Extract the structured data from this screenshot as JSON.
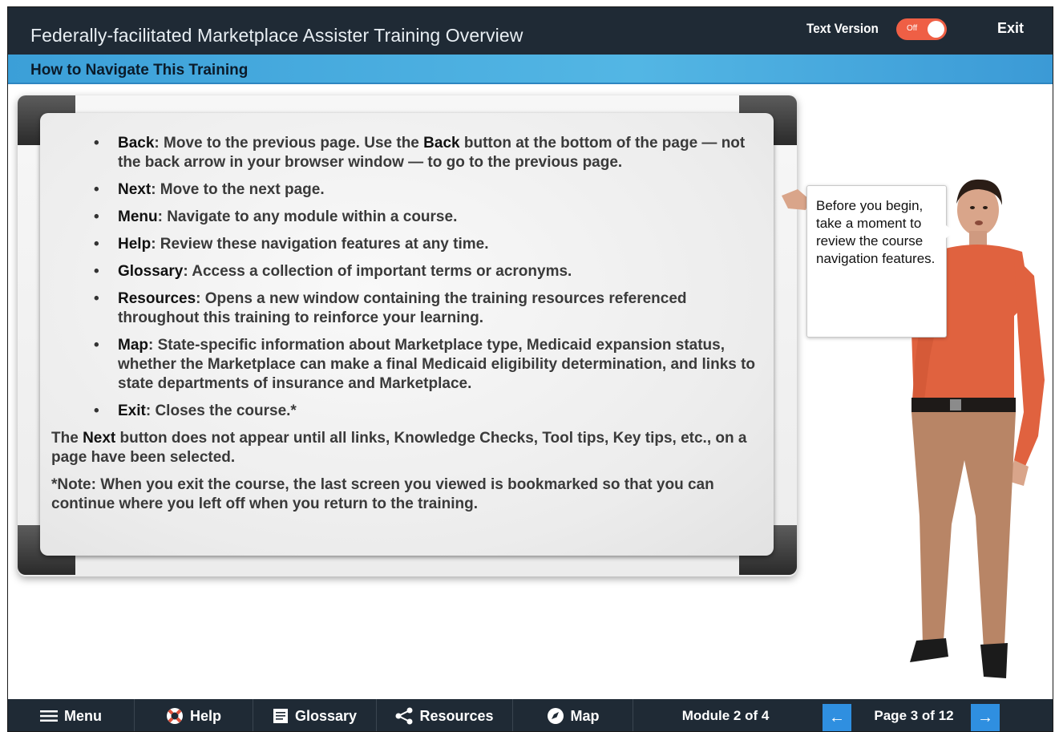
{
  "header": {
    "app_title": "Federally-facilitated Marketplace Assister Training Overview",
    "text_version_label": "Text Version",
    "toggle_state": "Off",
    "exit_label": "Exit"
  },
  "subheader": {
    "page_title": "How to Navigate This Training"
  },
  "board": {
    "items": [
      {
        "term": "Back",
        "desc_parts": [
          ": Move to the previous page. Use the ",
          "Back",
          " button at the bottom of the page — not the back arrow in your browser window — to go to the previous page."
        ]
      },
      {
        "term": "Next",
        "desc": ": Move to the next page."
      },
      {
        "term": "Menu",
        "desc": ": Navigate to any module within a course."
      },
      {
        "term": "Help",
        "desc": ": Review these navigation features at any time."
      },
      {
        "term": "Glossary",
        "desc": ": Access a collection of important terms or acronyms."
      },
      {
        "term": "Resources",
        "desc": ": Opens a new window containing the training resources referenced throughout this training to reinforce your learning."
      },
      {
        "term": "Map",
        "desc": ": State-specific information about Marketplace type, Medicaid expansion status, whether the Marketplace can make a final Medicaid eligibility determination, and links to state departments of insurance and Marketplace."
      },
      {
        "term": "Exit",
        "desc": ": Closes the course.*"
      }
    ],
    "note1_pre": "The ",
    "note1_term": "Next",
    "note1_post": " button does not appear until all links, Knowledge Checks, Tool tips, Key tips, etc., on a page have been selected.",
    "note2": "*Note: When you exit the course, the last screen you viewed is bookmarked so that you can continue where you left off when you return to the training."
  },
  "bubble": {
    "text": "Before you begin, take a moment to review the course navigation features."
  },
  "footer": {
    "menu_label": "Menu",
    "help_label": "Help",
    "glossary_label": "Glossary",
    "resources_label": "Resources",
    "map_label": "Map",
    "module_label": "Module 2 of 4",
    "prev_glyph": "←",
    "next_glyph": "→",
    "page_label": "Page 3 of 12"
  },
  "colors": {
    "topbar": "#1f2a35",
    "subbar": "#4aaee0",
    "toggle": "#ef5f45",
    "nav_arrow": "#2f8fe0"
  }
}
